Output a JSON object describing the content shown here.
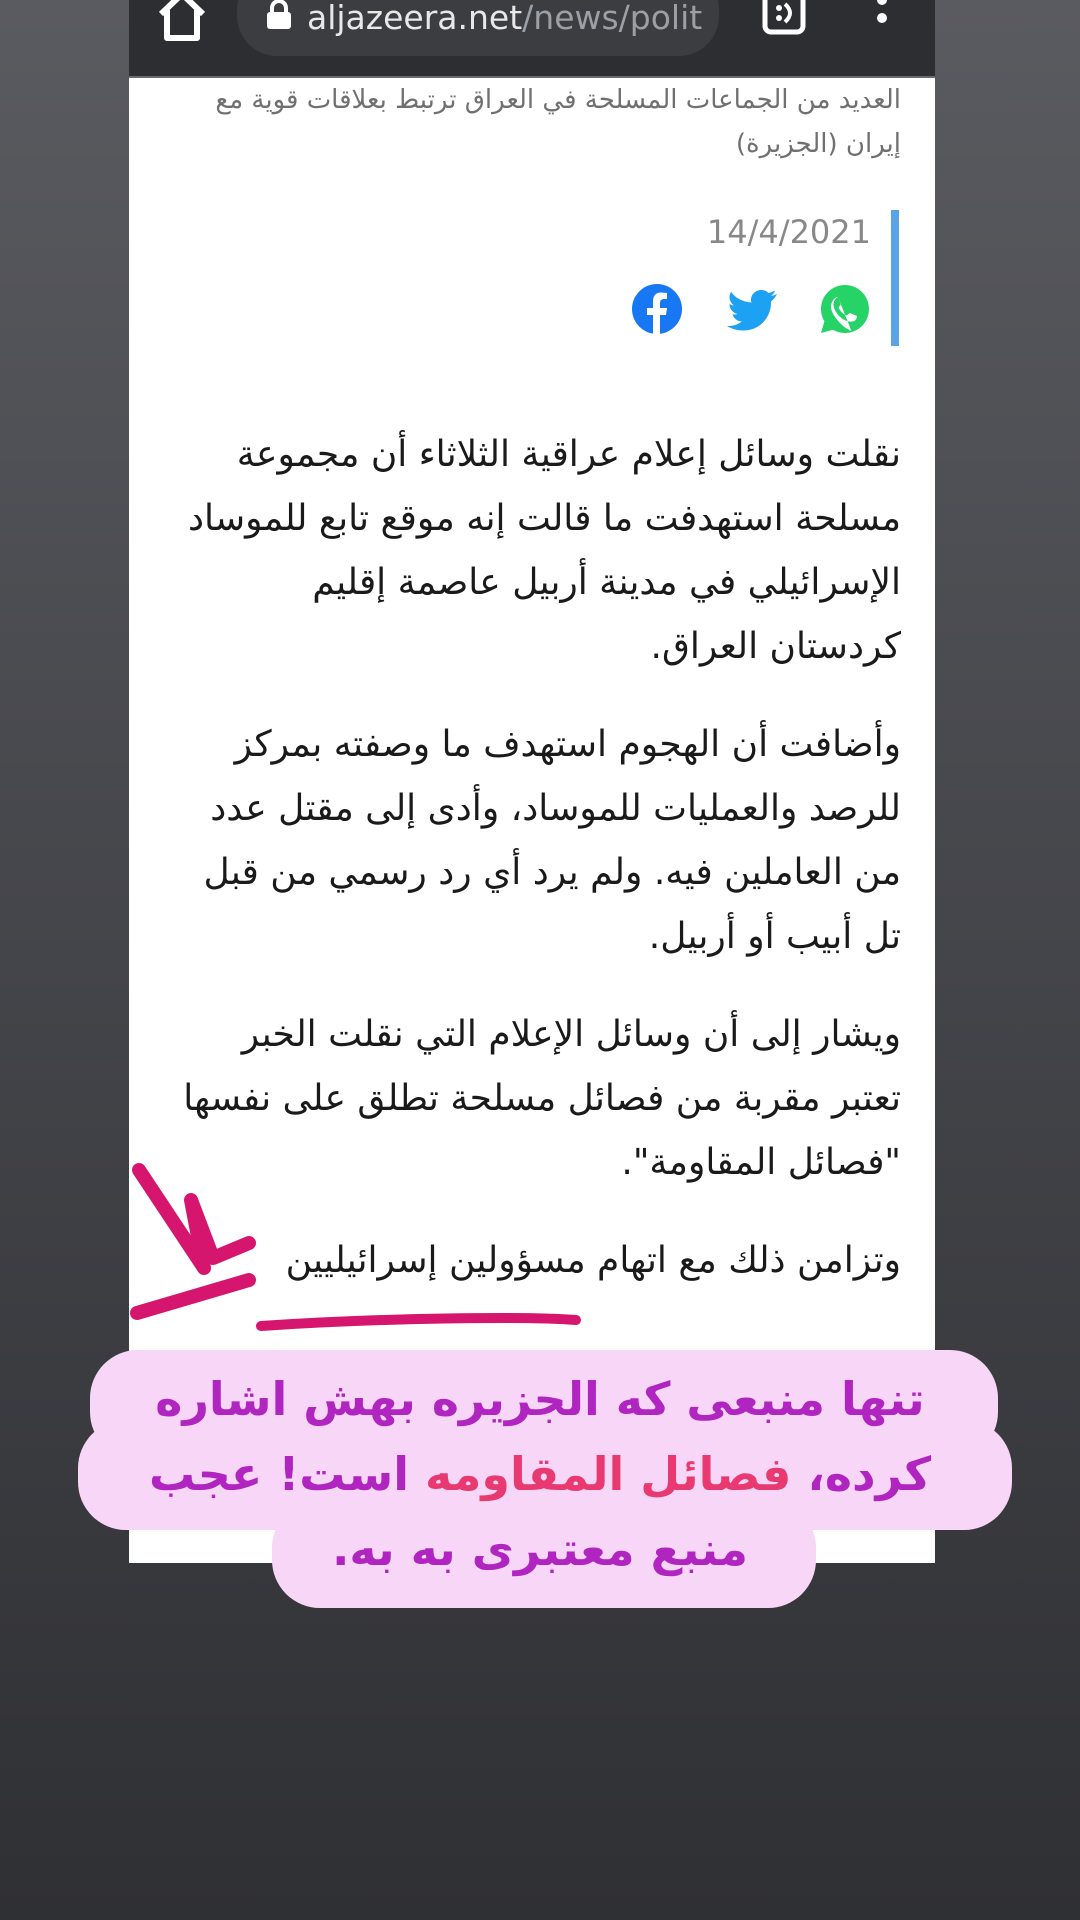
{
  "browser": {
    "url_host": "aljazeera.net",
    "url_path": "/news/polit",
    "home_icon": "home-icon",
    "lock_icon": "lock-icon",
    "tabs_icon": "tab-switcher-icon",
    "menu_icon": "more-vert-icon"
  },
  "article": {
    "image_caption": "العديد من الجماعات المسلحة في العراق ترتبط بعلاقات قوية مع إيران (الجزيرة)",
    "date": "14/4/2021",
    "share": [
      "facebook-icon",
      "twitter-icon",
      "whatsapp-icon"
    ],
    "paragraphs": [
      "نقلت وسائل إعلام عراقية الثلاثاء أن مجموعة مسلحة استهدفت ما قالت إنه موقع تابع للموساد الإسرائيلي في مدينة أربيل عاصمة إقليم كردستان العراق.",
      "وأضافت أن الهجوم استهدف ما وصفته بمركز للرصد والعمليات للموساد، وأدى إلى مقتل عدد من العاملين فيه. ولم يرد أي رد رسمي من قبل تل أبيب أو أربيل.",
      "ويشار إلى أن وسائل الإعلام التي نقلت الخبر تعتبر مقربة من فصائل مسلحة تطلق على نفسها \"فصائل المقاومة\".",
      "وتزامن ذلك مع اتهام مسؤولين إسرائيليين"
    ]
  },
  "annotation": {
    "line1": "تنها منبعی که الجزیره بهش اشاره",
    "line2_a": "کرده،",
    "line2_pink": "فصائل المقاومه",
    "line2_b": "است! عجب",
    "line3": "منبع معتبری به به.",
    "colors": {
      "text": "#b024c0",
      "highlight": "#e83a70",
      "bubble": "#f7d6f7",
      "marker": "#d6166e"
    }
  }
}
